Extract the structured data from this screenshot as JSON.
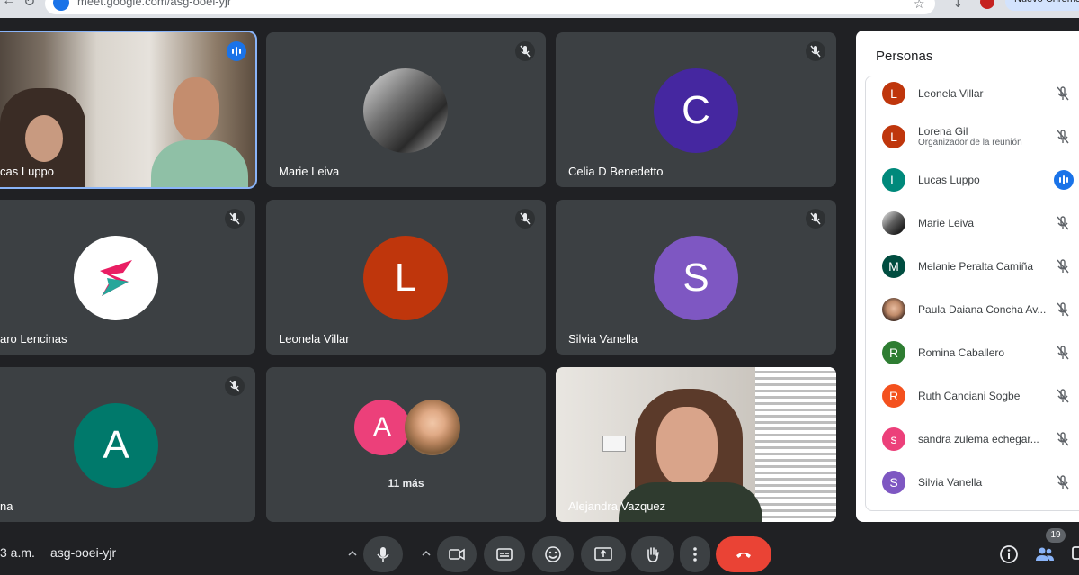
{
  "browser": {
    "url": "meet.google.com/asg-ooei-yjr",
    "chrome_pill": "Nuevo Chrome"
  },
  "tiles": [
    {
      "name": "Lucas Luppo",
      "shown_name": "cas Luppo"
    },
    {
      "name": "Marie Leiva"
    },
    {
      "name": "Celia D Benedetto",
      "initial": "C",
      "color": "#4527a0"
    },
    {
      "name": "Alvaro Lencinas",
      "shown_name": "aro Lencinas"
    },
    {
      "name": "Leonela Villar",
      "initial": "L",
      "color": "#bf360c"
    },
    {
      "name": "Silvia Vanella",
      "initial": "S",
      "color": "#7e57c2"
    },
    {
      "name": "Romina",
      "shown_name": "na",
      "initial": "A",
      "color": "#00796b"
    },
    {
      "more_text": "11 más",
      "initial": "A",
      "color": "#ec407a"
    },
    {
      "name": "Alejandra Vazquez"
    }
  ],
  "panel": {
    "title": "Personas",
    "people": [
      {
        "name": "Leonela Villar",
        "initial": "L",
        "color": "#bf360c",
        "mic": "off"
      },
      {
        "name": "Lorena Gil",
        "role": "Organizador de la reunión",
        "initial": "L",
        "color": "#bf360c",
        "mic": "off"
      },
      {
        "name": "Lucas Luppo",
        "initial": "L",
        "color": "#00897b",
        "mic": "speaking"
      },
      {
        "name": "Marie Leiva",
        "photo": true,
        "mic": "off"
      },
      {
        "name": "Melanie Peralta Camiña",
        "initial": "M",
        "color": "#004d40",
        "mic": "off"
      },
      {
        "name": "Paula Daiana Concha Av...",
        "photo": true,
        "mic": "off"
      },
      {
        "name": "Romina Caballero",
        "initial": "R",
        "color": "#2e7d32",
        "mic": "off"
      },
      {
        "name": "Ruth Canciani Sogbe",
        "initial": "R",
        "color": "#f4511e",
        "mic": "off"
      },
      {
        "name": "sandra zulema echegar...",
        "initial": "s",
        "color": "#ec407a",
        "mic": "off"
      },
      {
        "name": "Silvia Vanella",
        "initial": "S",
        "color": "#7e57c2",
        "mic": "off"
      }
    ]
  },
  "bottom": {
    "time": "3 a.m.",
    "meeting_code": "asg-ooei-yjr",
    "participant_count": "19"
  },
  "icons": {
    "mic": "microphone-icon",
    "camera": "camera-icon",
    "captions": "captions-icon",
    "emoji": "emoji-icon",
    "present": "present-screen-icon",
    "hand": "raise-hand-icon",
    "more": "more-vert-icon",
    "end": "end-call-icon",
    "info": "info-icon",
    "people": "people-icon",
    "chat": "chat-icon"
  }
}
